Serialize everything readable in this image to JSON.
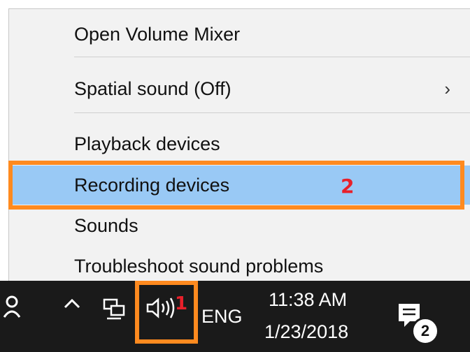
{
  "menu": {
    "items": [
      {
        "label": "Open Volume Mixer"
      },
      {
        "label": "Spatial sound (Off)",
        "submenu": true
      },
      {
        "label": "Playback devices"
      },
      {
        "label": "Recording devices",
        "highlighted": true
      },
      {
        "label": "Sounds"
      },
      {
        "label": "Troubleshoot sound problems"
      }
    ],
    "chevron": "›"
  },
  "annotations": {
    "step1": "1",
    "step2": "2",
    "box_color": "#ff8a1f",
    "number_color": "#e8202a"
  },
  "taskbar": {
    "person_icon": "person-icon",
    "caret": "^",
    "network_icon": "network-icon",
    "volume_icon": "volume-icon",
    "volume_glyph": "🔈)))",
    "language": "ENG",
    "time": "11:38 AM",
    "date": "1/23/2018",
    "notification_icon": "action-center-icon",
    "notification_count": "2"
  },
  "colors": {
    "menu_bg": "#f2f2f2",
    "highlight_bg": "#99c9f5",
    "taskbar_bg": "#1a1a1a"
  }
}
